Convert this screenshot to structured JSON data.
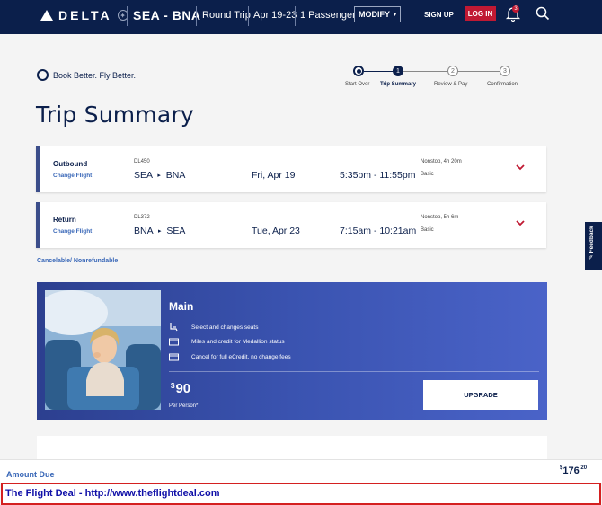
{
  "nav": {
    "brand": "DELTA",
    "route": "SEA - BNA",
    "trip_type": "Round Trip",
    "dates": "Apr 19-23",
    "passengers": "1 Passenger",
    "modify_label": "MODIFY",
    "signup_label": "SIGN UP",
    "login_label": "LOG IN",
    "notification_count": "3",
    "colors": {
      "navy": "#0b1f4b",
      "red": "#c01933"
    }
  },
  "tagline": "Book Better. Fly Better.",
  "steps": [
    {
      "label": "Start Over",
      "state": "icon"
    },
    {
      "label": "Trip Summary",
      "number": "1",
      "state": "active"
    },
    {
      "label": "Review & Pay",
      "number": "2",
      "state": "pending"
    },
    {
      "label": "Confirmation",
      "number": "3",
      "state": "pending"
    }
  ],
  "page_title": "Trip Summary",
  "flights": [
    {
      "direction": "Outbound",
      "change_label": "Change Flight",
      "flight_number": "DL450",
      "origin": "SEA",
      "destination": "BNA",
      "date": "Fri, Apr 19",
      "times": "5:35pm - 11:55pm",
      "duration": "Nonstop, 4h 20m",
      "fare": "Basic"
    },
    {
      "direction": "Return",
      "change_label": "Change Flight",
      "flight_number": "DL372",
      "origin": "BNA",
      "destination": "SEA",
      "date": "Tue, Apr 23",
      "times": "7:15am - 10:21am",
      "duration": "Nonstop, 5h 6m",
      "fare": "Basic"
    }
  ],
  "policy": "Cancelable/ Nonrefundable",
  "feedback_label": "Feedback",
  "upsell": {
    "product": "Main",
    "features": [
      {
        "icon": "seat-icon",
        "text": "Select and changes seats"
      },
      {
        "icon": "card-icon",
        "text": "Miles and credit for Medallion status"
      },
      {
        "icon": "card-icon",
        "text": "Cancel for full eCredit, no change fees"
      }
    ],
    "currency": "$",
    "price": "90",
    "per_person": "Per Person*",
    "upgrade_label": "UPGRADE"
  },
  "amount_due": {
    "label": "Amount Due",
    "currency": "$",
    "whole": "176",
    "cents": ".20"
  },
  "watermark": "The Flight Deal - http://www.theflightdeal.com"
}
